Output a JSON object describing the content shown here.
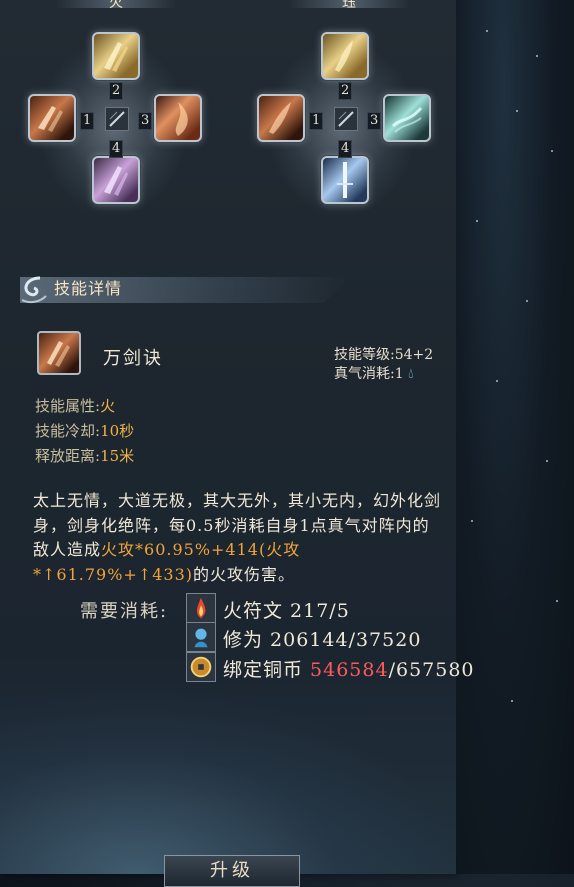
{
  "columns": [
    {
      "title": "火"
    },
    {
      "title": "珏"
    }
  ],
  "diagram_left": {
    "top": "2",
    "left": "1",
    "right": "3",
    "bottom": "4"
  },
  "diagram_right": {
    "top": "2",
    "left": "1",
    "right": "3",
    "bottom": "4"
  },
  "section": {
    "title": "技能详情"
  },
  "skill": {
    "name": "万剑诀",
    "level_label": "技能等级:",
    "level_value": "54+2",
    "qi_label": "真气消耗:",
    "qi_value": "1"
  },
  "attributes": [
    {
      "label": "技能属性:",
      "value": "火"
    },
    {
      "label": "技能冷却:",
      "value": "10秒"
    },
    {
      "label": "释放距离:",
      "value": "15米"
    }
  ],
  "description": {
    "part1": "太上无情，大道无极，其大无外，其小无内，幻外化剑身，剑身化绝阵，每0.5秒消耗自身1点真气对阵内的敌人造成",
    "highlight": "火攻*60.95%+414(火攻*↑61.79%+↑433)",
    "part2": "的火攻伤害。"
  },
  "cost": {
    "label": "需要消耗:",
    "items": [
      {
        "icon": "fire-rune-icon",
        "text": "火符文 217/5"
      },
      {
        "icon": "cultivation-icon",
        "text": "修为 206144/37520"
      },
      {
        "icon": "bound-coin-icon",
        "prefix": "绑定铜币 ",
        "current": "546584",
        "suffix": "/657580"
      }
    ]
  },
  "upgrade_button": "升级",
  "colors": {
    "highlight": "#f2a43a",
    "insufficient": "#ff5a5a",
    "attr_value": "#f0b24a"
  }
}
